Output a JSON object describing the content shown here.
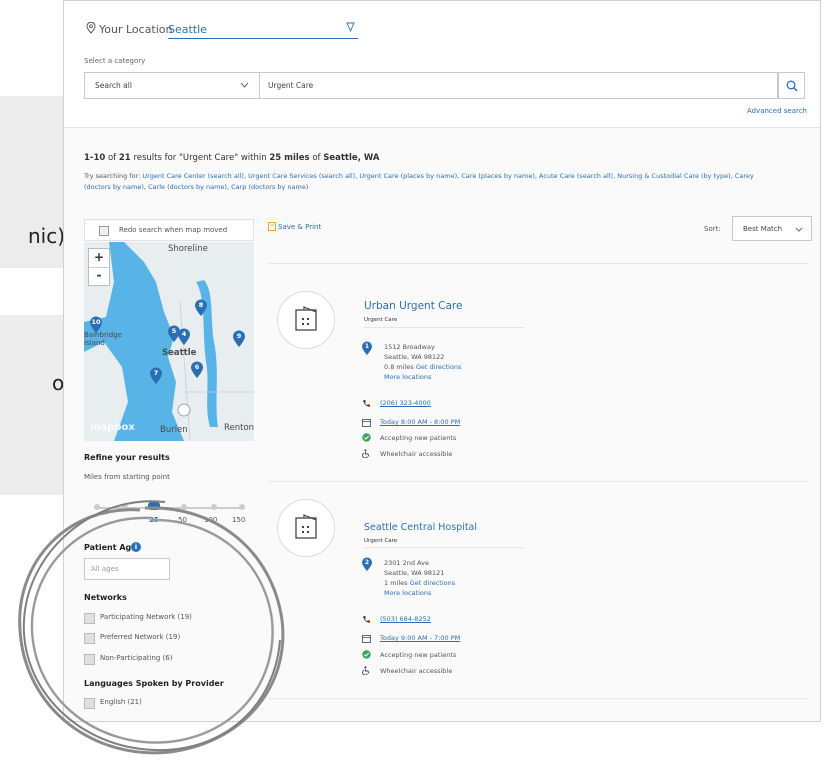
{
  "background": {
    "text_1": "nic).",
    "text_2": "o"
  },
  "location": {
    "label": "Your Location",
    "value": "Seattle"
  },
  "category": {
    "label": "Select a category",
    "selected": "Search all",
    "query": "Urgent Care",
    "advanced_link": "Advanced search"
  },
  "results": {
    "range": "1-10",
    "of_label": "of",
    "count": "21",
    "results_for": "results for \"Urgent Care\" within",
    "distance": "25 miles",
    "of_label2": "of",
    "place": "Seattle, WA",
    "try_label": "Try searching for:",
    "suggestions": [
      "Urgent Care Center (search all)",
      "Urgent Care Services (search all)",
      "Urgent Care (places by name)",
      "Care (places by name)",
      "Acute Care (search all)",
      "Nursing & Custodial Care (by type)",
      "Carey (doctors by name)",
      "Carle (doctors by name)",
      "Carp (doctors by name)"
    ]
  },
  "map": {
    "redo_label": "Redo search when map moved",
    "zoom_in": "+",
    "zoom_out": "-",
    "logo": "mapbox",
    "cities": [
      "Shoreline",
      "Seattle",
      "Burien",
      "Renton",
      "Bainbridge Island"
    ],
    "pins": [
      "10",
      "8",
      "5",
      "4",
      "9",
      "6",
      "7"
    ]
  },
  "filters": {
    "refine_title": "Refine your results",
    "miles_label": "Miles from starting point",
    "ticks": [
      "25",
      "50",
      "100",
      "150"
    ],
    "selected_miles": 25,
    "age_title": "Patient Age",
    "age_placeholder": "All ages",
    "networks_title": "Networks",
    "networks": [
      "Participating Network (19)",
      "Preferred Network (19)",
      "Non-Participating (6)"
    ],
    "languages_title": "Languages Spoken by Provider",
    "languages": [
      "English (21)"
    ]
  },
  "toolbar": {
    "save_print": "Save & Print",
    "sort_label": "Sort:",
    "sort_value": "Best Match"
  },
  "providers": [
    {
      "pin": "1",
      "name": "Urban Urgent Care",
      "type": "Urgent Care",
      "street": "1512 Broadway",
      "city": "Seattle, WA 98122",
      "distance": "0.8 miles",
      "directions": "Get directions",
      "more": "More locations",
      "phone": "(206) 323-4000",
      "hours": "Today 8:00 AM - 8:00 PM",
      "accepting": "Accepting new patients",
      "wheelchair": "Wheelchair accessible"
    },
    {
      "pin": "2",
      "name": "Seattle Central Hospital",
      "type": "Urgent Care",
      "street": "2301 2nd Ave",
      "city": "Seattle, WA 98121",
      "distance": "1 miles",
      "directions": "Get directions",
      "more": "More locations",
      "phone": "(503) 684-8252",
      "hours": "Today 9:00 AM - 7:00 PM",
      "accepting": "Accepting new patients",
      "wheelchair": "Wheelchair accessible"
    }
  ],
  "colors": {
    "link": "#2a6fb5",
    "map_water": "#58b4e6",
    "map_land": "#e8edf0",
    "pin": "#2a6fb5",
    "check_green": "#3aa55c"
  }
}
